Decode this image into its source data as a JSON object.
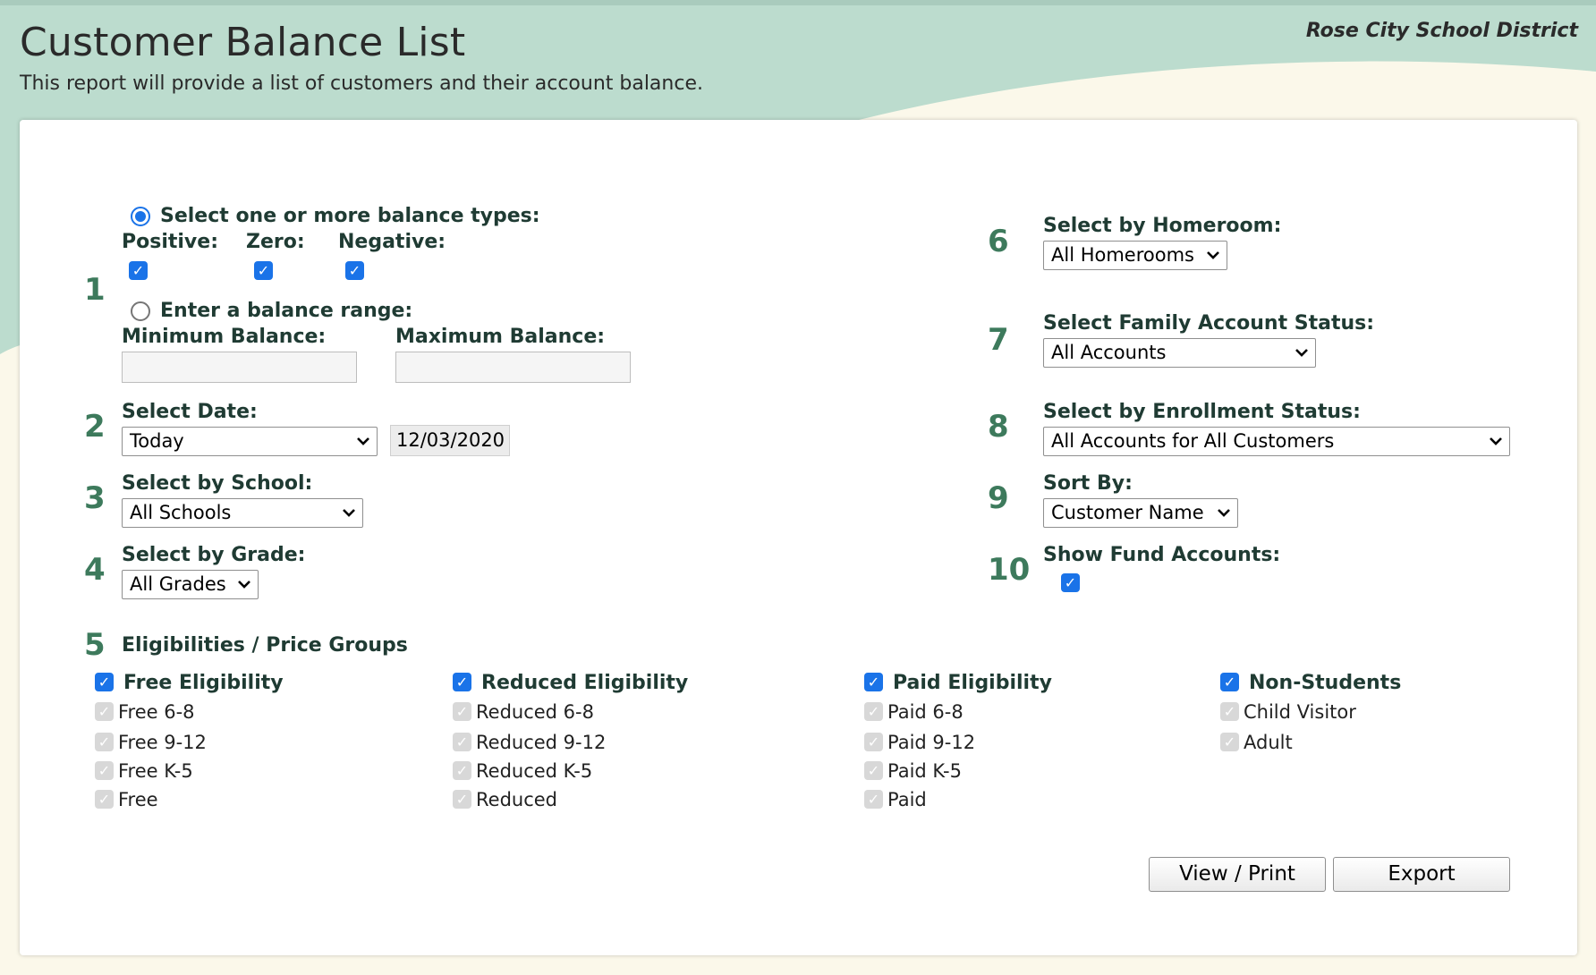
{
  "header": {
    "title": "Customer Balance List",
    "subtitle": "This report will provide a list of customers and their account balance.",
    "district": "Rose City School District"
  },
  "colors": {
    "header_bg": "#bcdcce",
    "accent_number": "#3d7a5c",
    "checkbox": "#1a73e8"
  },
  "section1": {
    "number": "1",
    "radio_types_label": "Select one or more balance types:",
    "positive_label": "Positive:",
    "zero_label": "Zero:",
    "negative_label": "Negative:",
    "positive_checked": true,
    "zero_checked": true,
    "negative_checked": true,
    "radio_range_label": "Enter a balance range:",
    "min_label": "Minimum Balance:",
    "max_label": "Maximum Balance:",
    "min_value": "",
    "max_value": ""
  },
  "section2": {
    "number": "2",
    "label": "Select Date:",
    "selected": "Today",
    "date_value": "12/03/2020"
  },
  "section3": {
    "number": "3",
    "label": "Select by School:",
    "selected": "All Schools"
  },
  "section4": {
    "number": "4",
    "label": "Select by Grade:",
    "selected": "All Grades"
  },
  "section5": {
    "number": "5",
    "label": "Eligibilities / Price Groups",
    "groups": [
      {
        "name": "Free Eligibility",
        "items": [
          "Free 6-8",
          "Free 9-12",
          "Free K-5",
          "Free"
        ]
      },
      {
        "name": "Reduced Eligibility",
        "items": [
          "Reduced 6-8",
          "Reduced 9-12",
          "Reduced K-5",
          "Reduced"
        ]
      },
      {
        "name": "Paid Eligibility",
        "items": [
          "Paid 6-8",
          "Paid 9-12",
          "Paid K-5",
          "Paid"
        ]
      },
      {
        "name": "Non-Students",
        "items": [
          "Child Visitor",
          "Adult"
        ]
      }
    ]
  },
  "section6": {
    "number": "6",
    "label": "Select by Homeroom:",
    "selected": "All Homerooms"
  },
  "section7": {
    "number": "7",
    "label": "Select Family Account Status:",
    "selected": "All Accounts"
  },
  "section8": {
    "number": "8",
    "label": "Select by Enrollment Status:",
    "selected": "All Accounts for All Customers"
  },
  "section9": {
    "number": "9",
    "label": "Sort By:",
    "selected": "Customer Name"
  },
  "section10": {
    "number": "10",
    "label": "Show Fund Accounts:",
    "checked": true
  },
  "buttons": {
    "view_print": "View / Print",
    "export": "Export"
  }
}
